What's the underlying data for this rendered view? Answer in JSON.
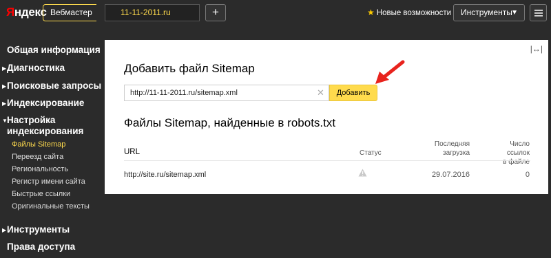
{
  "header": {
    "logo_y": "Я",
    "logo_rest": "ндекс",
    "service": "Вебмастер",
    "site": "11-11-2011.ru",
    "add_site": "+",
    "news": "Новые возможности",
    "tools": "Инструменты"
  },
  "sidebar": {
    "items": [
      {
        "label": "Общая информация",
        "expandable": false
      },
      {
        "label": "Диагностика",
        "expandable": true
      },
      {
        "label": "Поисковые запросы",
        "expandable": true
      },
      {
        "label": "Индексирование",
        "expandable": true
      },
      {
        "label": "Настройка индексирования",
        "expandable": true,
        "expanded": true
      },
      {
        "label": "Инструменты",
        "expandable": true
      },
      {
        "label": "Права доступа",
        "expandable": false
      }
    ],
    "subitems": [
      {
        "label": "Файлы Sitemap",
        "active": true
      },
      {
        "label": "Переезд сайта",
        "active": false
      },
      {
        "label": "Региональность",
        "active": false
      },
      {
        "label": "Регистр имени сайта",
        "active": false
      },
      {
        "label": "Быстрые ссылки",
        "active": false
      },
      {
        "label": "Оригинальные тексты",
        "active": false
      }
    ]
  },
  "main": {
    "title": "Добавить файл Sitemap",
    "input_value": "http://11-11-2011.ru/sitemap.xml",
    "add_button": "Добавить",
    "found_title": "Файлы Sitemap, найденные в robots.txt",
    "table": {
      "headers": {
        "url": "URL",
        "status": "Статус",
        "last_load_1": "Последняя",
        "last_load_2": "загрузка",
        "links_1": "Число ссылок",
        "links_2": "в файле"
      },
      "rows": [
        {
          "url": "http://site.ru/sitemap.xml",
          "status_icon": "warning-icon",
          "date": "29.07.2016",
          "links": "0"
        }
      ]
    }
  },
  "colors": {
    "accent": "#ffdb4d",
    "background": "#2b2b2b",
    "annotation": "#e8231d"
  }
}
